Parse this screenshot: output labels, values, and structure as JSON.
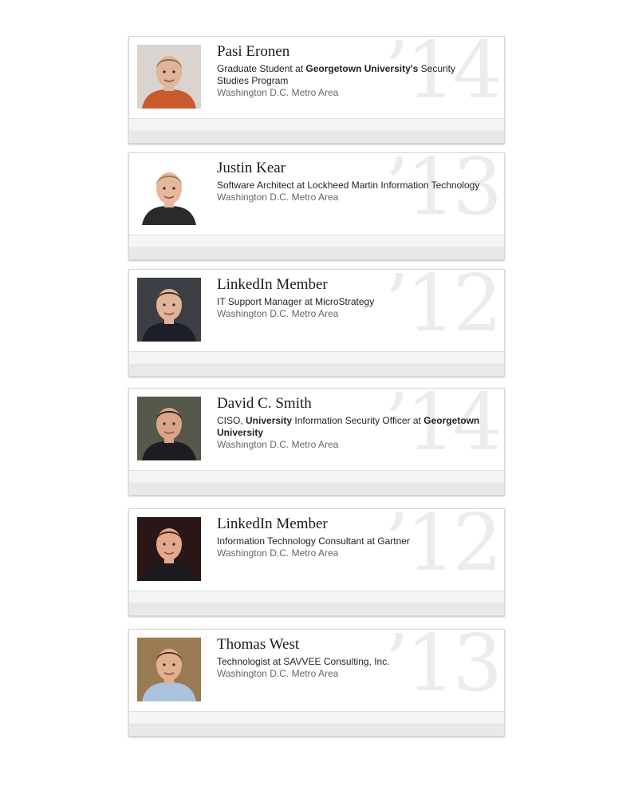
{
  "profiles": [
    {
      "name": "Pasi Eronen",
      "headline": [
        {
          "text": "Graduate Student at ",
          "bold": false
        },
        {
          "text": "Georgetown University's",
          "bold": true
        },
        {
          "text": " Security Studies Program",
          "bold": false
        }
      ],
      "location": "Washington D.C. Metro Area",
      "year": "’14",
      "photo": {
        "bg": "#d9d4cf",
        "skin": "#e0b49a",
        "hair": "#8a6a45",
        "shirt": "#c85a2e"
      }
    },
    {
      "name": "Justin Kear",
      "headline": [
        {
          "text": "Software Architect at Lockheed Martin Information Technology",
          "bold": false
        }
      ],
      "location": "Washington D.C. Metro Area",
      "year": "’13",
      "photo": {
        "bg": "#ffffff",
        "skin": "#e6b79c",
        "hair": "#9a7a55",
        "shirt": "#2a2a2a"
      }
    },
    {
      "name": "LinkedIn Member",
      "headline": [
        {
          "text": "IT Support Manager at MicroStrategy",
          "bold": false
        }
      ],
      "location": "Washington D.C. Metro Area",
      "year": "’12",
      "photo": {
        "bg": "#3c3f44",
        "skin": "#e1b39a",
        "hair": "#3a2a1e",
        "shirt": "#1c1f2a"
      }
    },
    {
      "name": "David C. Smith",
      "headline": [
        {
          "text": "CISO, ",
          "bold": false
        },
        {
          "text": "University",
          "bold": true
        },
        {
          "text": " Information Security Officer at ",
          "bold": false
        },
        {
          "text": "Georgetown University",
          "bold": true
        }
      ],
      "location": "Washington D.C. Metro Area",
      "year": "’14",
      "photo": {
        "bg": "#55584a",
        "skin": "#d9a487",
        "hair": "#2a1e16",
        "shirt": "#1e1e22"
      }
    },
    {
      "name": "LinkedIn Member",
      "headline": [
        {
          "text": "Information Technology Consultant at Gartner",
          "bold": false
        }
      ],
      "location": "Washington D.C. Metro Area",
      "year": "’12",
      "photo": {
        "bg": "#2a1616",
        "skin": "#e4a98c",
        "hair": "#3b2414",
        "shirt": "#1a1a20"
      }
    },
    {
      "name": "Thomas West",
      "headline": [
        {
          "text": "Technologist at SAVVEE Consulting, Inc.",
          "bold": false
        }
      ],
      "location": "Washington D.C. Metro Area",
      "year": "’13",
      "photo": {
        "bg": "#9a7a52",
        "skin": "#e3b08f",
        "hair": "#4a3020",
        "shirt": "#a9c2de"
      }
    }
  ]
}
